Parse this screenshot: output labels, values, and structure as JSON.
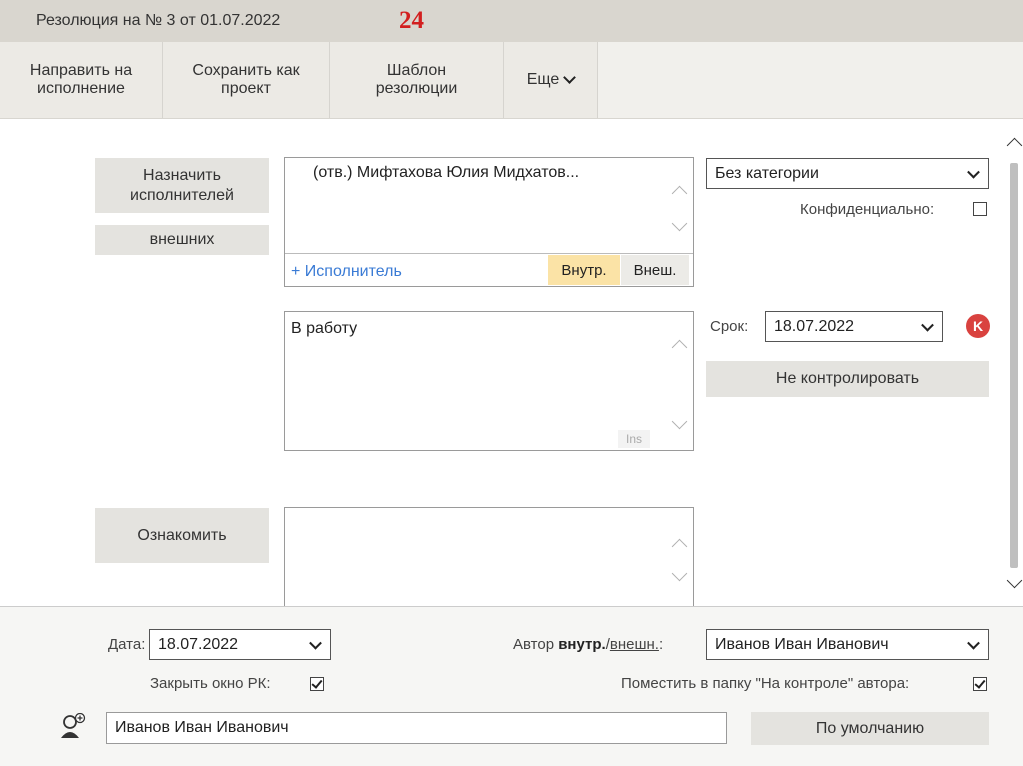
{
  "title": {
    "text": "Резолюция на № 3 от 01.07.2022",
    "badge": "24"
  },
  "toolbar": {
    "send": "Направить на\nисполнение",
    "save_draft": "Сохранить как\nпроект",
    "template": "Шаблон\nрезолюции",
    "more": "Еще"
  },
  "executors": {
    "assign_button": "Назначить\nисполнителей",
    "external_button": "внешних",
    "list": [
      "(отв.)  Мифтахова Юлия Мидхатов..."
    ],
    "add_link": "+ Исполнитель",
    "tab_internal": "Внутр.",
    "tab_external": "Внеш."
  },
  "category": {
    "selected": "Без категории"
  },
  "confidential": {
    "label": "Конфиденциально:",
    "checked": false
  },
  "task": {
    "text": "В работу",
    "ins_label": "Ins"
  },
  "deadline": {
    "label": "Срок:",
    "value": "18.07.2022",
    "badge": "K",
    "no_control": "Не контролировать"
  },
  "acquaint": {
    "button": "Ознакомить"
  },
  "footer": {
    "date_label": "Дата:",
    "date_value": "18.07.2022",
    "author_prefix": "Автор",
    "author_internal": "внутр.",
    "author_sep": "/",
    "author_external": "внешн.",
    "author_colon": ":",
    "author_value": "Иванов Иван Иванович",
    "close_rk_label": "Закрыть окно РК:",
    "close_rk_checked": true,
    "control_folder_label": "Поместить в папку \"На контроле\" автора:",
    "control_folder_checked": true,
    "signer_value": "Иванов Иван Иванович",
    "default_button": "По умолчанию"
  },
  "colors": {
    "accent_red": "#d21f1f",
    "tab_active": "#fbe3a6",
    "link_blue": "#3a7bd5"
  }
}
